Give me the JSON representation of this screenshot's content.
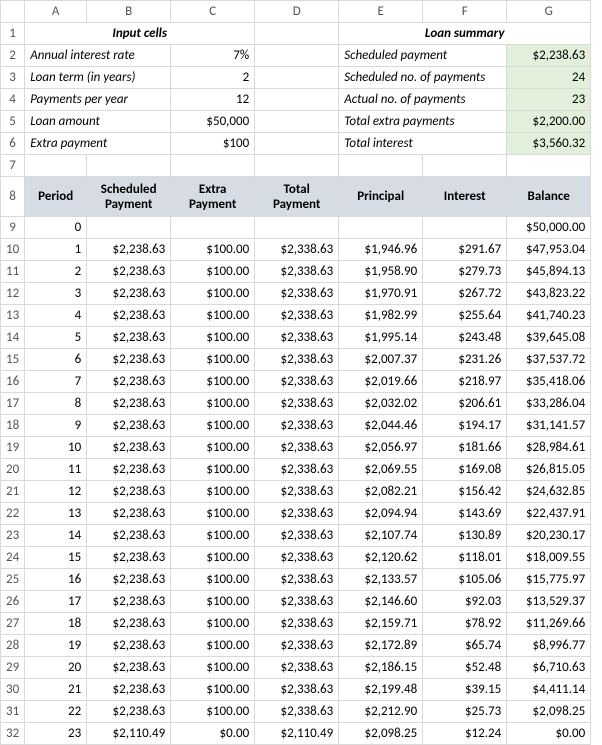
{
  "columns": [
    "A",
    "B",
    "C",
    "D",
    "E",
    "F",
    "G"
  ],
  "section_titles": {
    "input": "Input cells",
    "summary": "Loan summary"
  },
  "input_labels": {
    "rate": "Annual interest rate",
    "term": "Loan term (in years)",
    "ppy": "Payments per year",
    "amount": "Loan amount",
    "extra": "Extra payment"
  },
  "input_values": {
    "rate": "7%",
    "term": "2",
    "ppy": "12",
    "amount": "$50,000",
    "extra": "$100"
  },
  "summary_labels": {
    "scheduled_payment": "Scheduled payment",
    "scheduled_no": "Scheduled no. of payments",
    "actual_no": "Actual no. of payments",
    "total_extra": "Total extra payments",
    "total_interest": "Total interest"
  },
  "summary_values": {
    "scheduled_payment": "$2,238.63",
    "scheduled_no": "24",
    "actual_no": "23",
    "total_extra": "$2,200.00",
    "total_interest": "$3,560.32"
  },
  "headers": {
    "period": "Period",
    "scheduled": "Scheduled Payment",
    "extra": "Extra Payment",
    "total": "Total Payment",
    "principal": "Principal",
    "interest": "Interest",
    "balance": "Balance"
  },
  "chart_data": {
    "type": "table",
    "columns": [
      "Period",
      "Scheduled Payment",
      "Extra Payment",
      "Total Payment",
      "Principal",
      "Interest",
      "Balance"
    ],
    "rows": [
      {
        "period": "0",
        "scheduled": "",
        "extra": "",
        "total": "",
        "principal": "",
        "interest": "",
        "balance": "$50,000.00"
      },
      {
        "period": "1",
        "scheduled": "$2,238.63",
        "extra": "$100.00",
        "total": "$2,338.63",
        "principal": "$1,946.96",
        "interest": "$291.67",
        "balance": "$47,953.04"
      },
      {
        "period": "2",
        "scheduled": "$2,238.63",
        "extra": "$100.00",
        "total": "$2,338.63",
        "principal": "$1,958.90",
        "interest": "$279.73",
        "balance": "$45,894.13"
      },
      {
        "period": "3",
        "scheduled": "$2,238.63",
        "extra": "$100.00",
        "total": "$2,338.63",
        "principal": "$1,970.91",
        "interest": "$267.72",
        "balance": "$43,823.22"
      },
      {
        "period": "4",
        "scheduled": "$2,238.63",
        "extra": "$100.00",
        "total": "$2,338.63",
        "principal": "$1,982.99",
        "interest": "$255.64",
        "balance": "$41,740.23"
      },
      {
        "period": "5",
        "scheduled": "$2,238.63",
        "extra": "$100.00",
        "total": "$2,338.63",
        "principal": "$1,995.14",
        "interest": "$243.48",
        "balance": "$39,645.08"
      },
      {
        "period": "6",
        "scheduled": "$2,238.63",
        "extra": "$100.00",
        "total": "$2,338.63",
        "principal": "$2,007.37",
        "interest": "$231.26",
        "balance": "$37,537.72"
      },
      {
        "period": "7",
        "scheduled": "$2,238.63",
        "extra": "$100.00",
        "total": "$2,338.63",
        "principal": "$2,019.66",
        "interest": "$218.97",
        "balance": "$35,418.06"
      },
      {
        "period": "8",
        "scheduled": "$2,238.63",
        "extra": "$100.00",
        "total": "$2,338.63",
        "principal": "$2,032.02",
        "interest": "$206.61",
        "balance": "$33,286.04"
      },
      {
        "period": "9",
        "scheduled": "$2,238.63",
        "extra": "$100.00",
        "total": "$2,338.63",
        "principal": "$2,044.46",
        "interest": "$194.17",
        "balance": "$31,141.57"
      },
      {
        "period": "10",
        "scheduled": "$2,238.63",
        "extra": "$100.00",
        "total": "$2,338.63",
        "principal": "$2,056.97",
        "interest": "$181.66",
        "balance": "$28,984.61"
      },
      {
        "period": "11",
        "scheduled": "$2,238.63",
        "extra": "$100.00",
        "total": "$2,338.63",
        "principal": "$2,069.55",
        "interest": "$169.08",
        "balance": "$26,815.05"
      },
      {
        "period": "12",
        "scheduled": "$2,238.63",
        "extra": "$100.00",
        "total": "$2,338.63",
        "principal": "$2,082.21",
        "interest": "$156.42",
        "balance": "$24,632.85"
      },
      {
        "period": "13",
        "scheduled": "$2,238.63",
        "extra": "$100.00",
        "total": "$2,338.63",
        "principal": "$2,094.94",
        "interest": "$143.69",
        "balance": "$22,437.91"
      },
      {
        "period": "14",
        "scheduled": "$2,238.63",
        "extra": "$100.00",
        "total": "$2,338.63",
        "principal": "$2,107.74",
        "interest": "$130.89",
        "balance": "$20,230.17"
      },
      {
        "period": "15",
        "scheduled": "$2,238.63",
        "extra": "$100.00",
        "total": "$2,338.63",
        "principal": "$2,120.62",
        "interest": "$118.01",
        "balance": "$18,009.55"
      },
      {
        "period": "16",
        "scheduled": "$2,238.63",
        "extra": "$100.00",
        "total": "$2,338.63",
        "principal": "$2,133.57",
        "interest": "$105.06",
        "balance": "$15,775.97"
      },
      {
        "period": "17",
        "scheduled": "$2,238.63",
        "extra": "$100.00",
        "total": "$2,338.63",
        "principal": "$2,146.60",
        "interest": "$92.03",
        "balance": "$13,529.37"
      },
      {
        "period": "18",
        "scheduled": "$2,238.63",
        "extra": "$100.00",
        "total": "$2,338.63",
        "principal": "$2,159.71",
        "interest": "$78.92",
        "balance": "$11,269.66"
      },
      {
        "period": "19",
        "scheduled": "$2,238.63",
        "extra": "$100.00",
        "total": "$2,338.63",
        "principal": "$2,172.89",
        "interest": "$65.74",
        "balance": "$8,996.77"
      },
      {
        "period": "20",
        "scheduled": "$2,238.63",
        "extra": "$100.00",
        "total": "$2,338.63",
        "principal": "$2,186.15",
        "interest": "$52.48",
        "balance": "$6,710.63"
      },
      {
        "period": "21",
        "scheduled": "$2,238.63",
        "extra": "$100.00",
        "total": "$2,338.63",
        "principal": "$2,199.48",
        "interest": "$39.15",
        "balance": "$4,411.14"
      },
      {
        "period": "22",
        "scheduled": "$2,238.63",
        "extra": "$100.00",
        "total": "$2,338.63",
        "principal": "$2,212.90",
        "interest": "$25.73",
        "balance": "$2,098.25"
      },
      {
        "period": "23",
        "scheduled": "$2,110.49",
        "extra": "$0.00",
        "total": "$2,110.49",
        "principal": "$2,098.25",
        "interest": "$12.24",
        "balance": "$0.00"
      }
    ]
  }
}
